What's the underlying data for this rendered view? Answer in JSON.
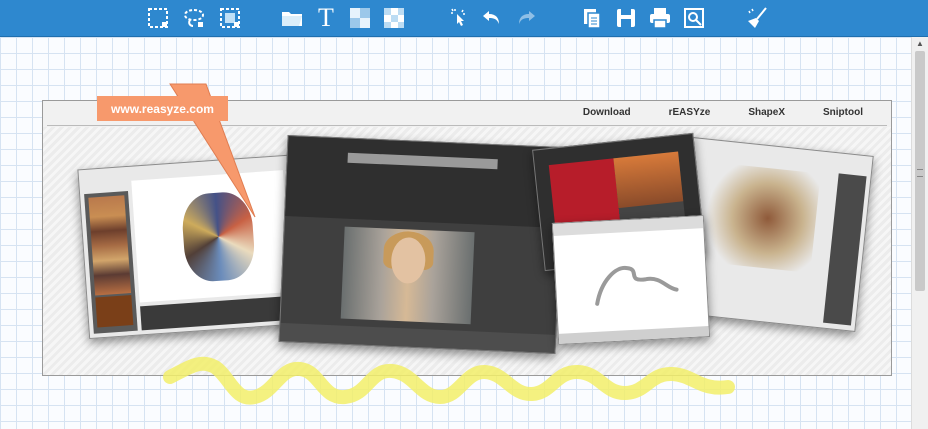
{
  "toolbar": {
    "tools": [
      {
        "name": "rect-select-icon"
      },
      {
        "name": "lasso-select-icon"
      },
      {
        "name": "window-select-icon"
      },
      {
        "name": "open-folder-icon"
      },
      {
        "name": "text-tool-icon",
        "glyph": "T"
      },
      {
        "name": "pixelate-icon"
      },
      {
        "name": "blur-icon"
      },
      {
        "name": "magic-pointer-icon"
      },
      {
        "name": "undo-icon"
      },
      {
        "name": "redo-icon"
      },
      {
        "name": "copy-icon"
      },
      {
        "name": "save-icon"
      },
      {
        "name": "print-icon"
      },
      {
        "name": "preview-icon"
      },
      {
        "name": "clear-broom-icon"
      }
    ],
    "color": "#2e88cf"
  },
  "canvas": {
    "callout_text": "www.reasyze.com",
    "callout_color": "#f7996c",
    "highlighter_color": "#f2ef6a"
  },
  "snapshot": {
    "nav": [
      "Download",
      "rEASYze",
      "ShapeX",
      "Sniptool"
    ]
  }
}
